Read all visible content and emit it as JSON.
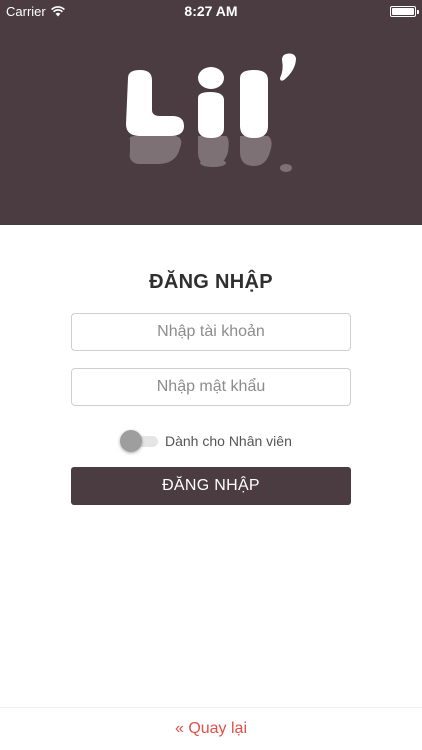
{
  "status_bar": {
    "carrier": "Carrier",
    "time": "8:27 AM",
    "icons": [
      "wifi-icon",
      "battery-icon"
    ]
  },
  "logo": {
    "text": "Lil'"
  },
  "login": {
    "title": "ĐĂNG NHẬP",
    "username_placeholder": "Nhập tài khoản",
    "username_value": "",
    "password_placeholder": "Nhập mật khẩu",
    "password_value": "",
    "staff_toggle_label": "Dành cho Nhân viên",
    "staff_toggle_on": false,
    "submit_label": "ĐĂNG NHẬP"
  },
  "footer": {
    "back_label": "« Quay lại"
  },
  "colors": {
    "header_bg": "#4a3c41",
    "button_bg": "#4a3c41",
    "link": "#e0504a"
  }
}
